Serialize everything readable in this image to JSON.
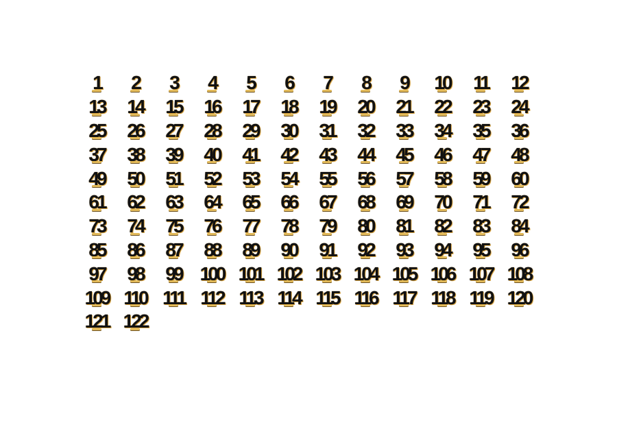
{
  "numbers": [
    "1",
    "2",
    "3",
    "4",
    "5",
    "6",
    "7",
    "8",
    "9",
    "10",
    "11",
    "12",
    "13",
    "14",
    "15",
    "16",
    "17",
    "18",
    "19",
    "20",
    "21",
    "22",
    "23",
    "24",
    "25",
    "26",
    "27",
    "28",
    "29",
    "30",
    "31",
    "32",
    "33",
    "34",
    "35",
    "36",
    "37",
    "38",
    "39",
    "40",
    "41",
    "42",
    "43",
    "44",
    "45",
    "46",
    "47",
    "48",
    "49",
    "50",
    "51",
    "52",
    "53",
    "54",
    "55",
    "56",
    "57",
    "58",
    "59",
    "60",
    "61",
    "62",
    "63",
    "64",
    "65",
    "66",
    "67",
    "68",
    "69",
    "70",
    "71",
    "72",
    "73",
    "74",
    "75",
    "76",
    "77",
    "78",
    "79",
    "80",
    "81",
    "82",
    "83",
    "84",
    "85",
    "86",
    "87",
    "88",
    "89",
    "90",
    "91",
    "92",
    "93",
    "94",
    "95",
    "96",
    "97",
    "98",
    "99",
    "100",
    "101",
    "102",
    "103",
    "104",
    "105",
    "106",
    "107",
    "108",
    "109",
    "110",
    "111",
    "112",
    "113",
    "114",
    "115",
    "116",
    "117",
    "118",
    "119",
    "120",
    "121",
    "122"
  ],
  "colors": {
    "text": "#111111",
    "glow": "#e0b44a",
    "background": "#ffffff"
  }
}
